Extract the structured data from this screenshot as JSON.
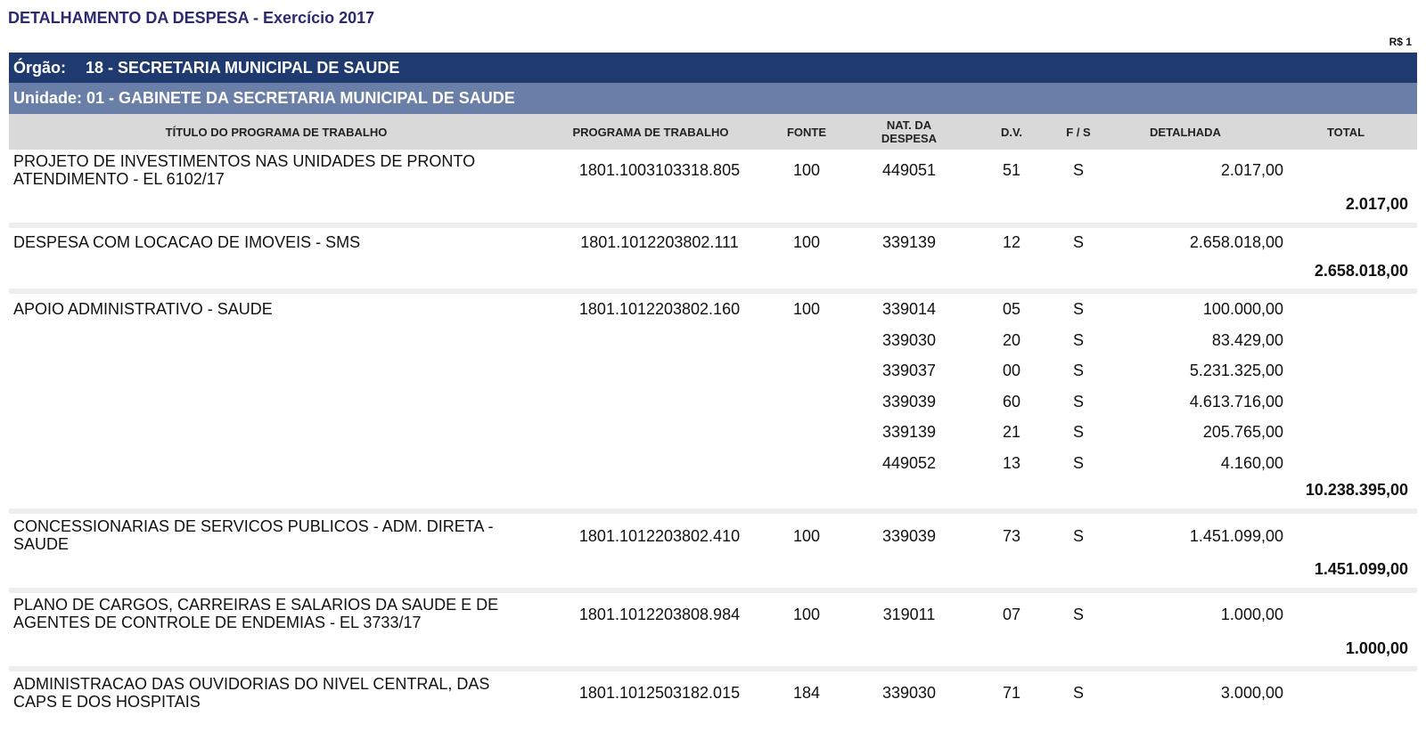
{
  "header": {
    "title": "DETALHAMENTO DA DESPESA",
    "subtitle": " - Exercício 2017",
    "currency": "R$ 1"
  },
  "orgao": {
    "label": "Órgão:",
    "value": "18 - SECRETARIA MUNICIPAL DE SAUDE"
  },
  "unidade": {
    "text": "Unidade: 01 - GABINETE DA SECRETARIA MUNICIPAL DE SAUDE"
  },
  "columns": {
    "titulo": "TÍTULO DO PROGRAMA DE TRABALHO",
    "programa": "PROGRAMA DE TRABALHO",
    "fonte": "FONTE",
    "nat": "NAT. DA DESPESA",
    "dv": "D.V.",
    "fs": "F / S",
    "detalhada": "DETALHADA",
    "total": "TOTAL"
  },
  "groups": [
    {
      "title": "PROJETO DE INVESTIMENTOS NAS UNIDADES DE PRONTO ATENDIMENTO - EL 6102/17",
      "programa": "1801.1003103318.805",
      "fonte": "100",
      "rows": [
        {
          "nat": "449051",
          "dv": "51",
          "fs": "S",
          "detalhada": "2.017,00"
        }
      ],
      "total": "2.017,00"
    },
    {
      "title": "DESPESA COM LOCACAO DE IMOVEIS - SMS",
      "programa": "1801.1012203802.111",
      "fonte": "100",
      "rows": [
        {
          "nat": "339139",
          "dv": "12",
          "fs": "S",
          "detalhada": "2.658.018,00"
        }
      ],
      "total": "2.658.018,00"
    },
    {
      "title": "APOIO ADMINISTRATIVO - SAUDE",
      "programa": "1801.1012203802.160",
      "fonte": "100",
      "rows": [
        {
          "nat": "339014",
          "dv": "05",
          "fs": "S",
          "detalhada": "100.000,00"
        },
        {
          "nat": "339030",
          "dv": "20",
          "fs": "S",
          "detalhada": "83.429,00"
        },
        {
          "nat": "339037",
          "dv": "00",
          "fs": "S",
          "detalhada": "5.231.325,00"
        },
        {
          "nat": "339039",
          "dv": "60",
          "fs": "S",
          "detalhada": "4.613.716,00"
        },
        {
          "nat": "339139",
          "dv": "21",
          "fs": "S",
          "detalhada": "205.765,00"
        },
        {
          "nat": "449052",
          "dv": "13",
          "fs": "S",
          "detalhada": "4.160,00"
        }
      ],
      "total": "10.238.395,00"
    },
    {
      "title": "CONCESSIONARIAS DE SERVICOS PUBLICOS - ADM. DIRETA - SAUDE",
      "programa": "1801.1012203802.410",
      "fonte": "100",
      "rows": [
        {
          "nat": "339039",
          "dv": "73",
          "fs": "S",
          "detalhada": "1.451.099,00"
        }
      ],
      "total": "1.451.099,00"
    },
    {
      "title": "PLANO DE CARGOS, CARREIRAS E SALARIOS DA SAUDE E DE AGENTES DE CONTROLE DE ENDEMIAS - EL 3733/17",
      "programa": "1801.1012203808.984",
      "fonte": "100",
      "rows": [
        {
          "nat": "319011",
          "dv": "07",
          "fs": "S",
          "detalhada": "1.000,00"
        }
      ],
      "total": "1.000,00"
    },
    {
      "title": "ADMINISTRACAO DAS OUVIDORIAS DO NIVEL CENTRAL, DAS CAPS E DOS HOSPITAIS",
      "programa": "1801.1012503182.015",
      "fonte": "184",
      "rows": [
        {
          "nat": "339030",
          "dv": "71",
          "fs": "S",
          "detalhada": "3.000,00"
        }
      ],
      "total": ""
    }
  ]
}
